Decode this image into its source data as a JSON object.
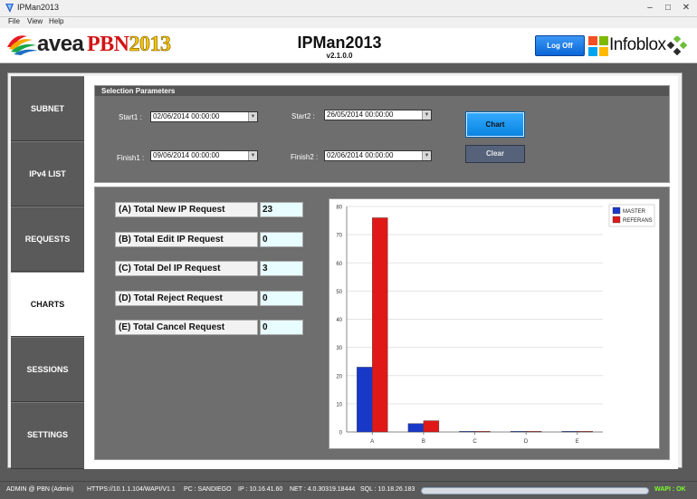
{
  "window": {
    "title": "IPMan2013"
  },
  "menu": [
    "File",
    "View",
    "Help"
  ],
  "header": {
    "brand_avea": "avea",
    "brand_pbn": "PBN",
    "brand_year": "2013",
    "app_name": "IPMan2013",
    "version": "v2.1.0.0",
    "logoff_label": "Log Off",
    "partner": "Infoblox"
  },
  "nav": {
    "items": [
      {
        "label": "SUBNET"
      },
      {
        "label": "IPv4 LIST"
      },
      {
        "label": "REQUESTS"
      },
      {
        "label": "CHARTS",
        "active": true
      },
      {
        "label": "SESSIONS"
      },
      {
        "label": "SETTINGS"
      }
    ]
  },
  "selection": {
    "title": "Selection Parameters",
    "start1_label": "Start1 :",
    "start1_value": "02/06/2014 00:00:00",
    "finish1_label": "Finish1 :",
    "finish1_value": "09/06/2014 00:00:00",
    "start2_label": "Start2 :",
    "start2_value": "26/05/2014 00:00:00",
    "finish2_label": "Finish2 :",
    "finish2_value": "02/06/2014 00:00:00",
    "chart_button": "Chart",
    "clear_button": "Clear"
  },
  "stats": [
    {
      "label": "(A)  Total New IP Request",
      "value": "23"
    },
    {
      "label": "(B)  Total Edit IP Request",
      "value": "0"
    },
    {
      "label": "(C)  Total Del IP Request",
      "value": "3"
    },
    {
      "label": "(D)  Total Reject Request",
      "value": "0"
    },
    {
      "label": "(E)  Total Cancel Request",
      "value": "0"
    }
  ],
  "chart_data": {
    "type": "bar",
    "categories": [
      "A",
      "B",
      "C",
      "D",
      "E"
    ],
    "series": [
      {
        "name": "MASTER",
        "values": [
          23,
          3,
          0,
          0,
          0
        ],
        "color": "#1838c8"
      },
      {
        "name": "REFERANS",
        "values": [
          76,
          4,
          0,
          0,
          0
        ],
        "color": "#e01818"
      }
    ],
    "title": "",
    "xlabel": "",
    "ylabel": "",
    "ylim": [
      0,
      80
    ],
    "yticks": [
      0,
      10,
      20,
      30,
      40,
      50,
      60,
      70,
      80
    ],
    "grid": true,
    "legend": "top-right"
  },
  "status": {
    "user": "ADMIN @ PBN (Admin)",
    "url": "HTTPS://10.1.1.104/WAPI/V1.1",
    "pc": "PC : SANDIEGO",
    "ip": "IP : 10.16.41.60",
    "net": "NET : 4.0.30319.18444",
    "sql": "SQL : 10.18.26.183",
    "wapi": "WAPI : OK"
  }
}
